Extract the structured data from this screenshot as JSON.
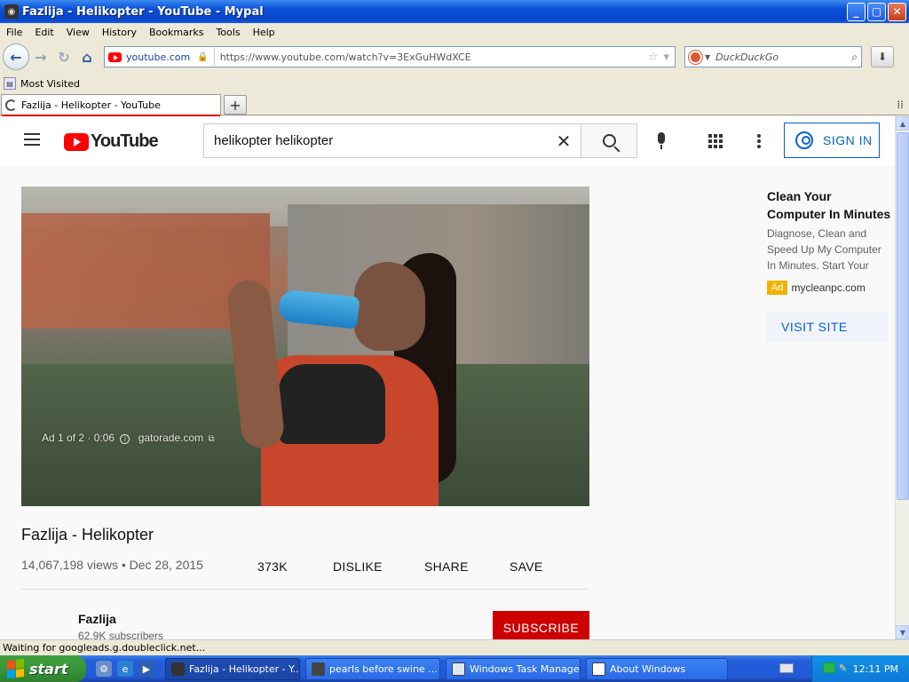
{
  "window": {
    "title": "Fazlija - Helikopter - YouTube - Mypal",
    "controls": {
      "minimize": "_",
      "maximize": "▢",
      "close": "✕"
    }
  },
  "menu": [
    "File",
    "Edit",
    "View",
    "History",
    "Bookmarks",
    "Tools",
    "Help"
  ],
  "navbar": {
    "site_host": "youtube.com",
    "url": "https://www.youtube.com/watch?v=3ExGuHWdXCE",
    "search_placeholder": "DuckDuckGo"
  },
  "bookmarks": {
    "most_visited": "Most Visited"
  },
  "tabs": [
    {
      "label": "Fazlija - Helikopter - YouTube",
      "active": true
    }
  ],
  "youtube": {
    "logo_text": "YouTube",
    "search_query": "helikopter helikopter",
    "sign_in": "SIGN IN",
    "video": {
      "ad_label": "Ad 1 of 2 · 0:06",
      "ad_domain": "gatorade.com",
      "title": "Fazlija - Helikopter",
      "meta": "14,067,198 views • Dec 28, 2015",
      "likes": "373K",
      "dislike": "DISLIKE",
      "share": "SHARE",
      "save": "SAVE"
    },
    "channel": {
      "name": "Fazlija",
      "subscribers": "62.9K subscribers",
      "subscribe": "SUBSCRIBE"
    },
    "side_ad": {
      "title": "Clean Your Computer In Minutes",
      "description": "Diagnose, Clean and Speed Up My Computer In Minutes. Start Your",
      "badge": "Ad",
      "domain": "mycleanpc.com",
      "cta": "VISIT SITE"
    }
  },
  "status": "Waiting for googleads.g.doubleclick.net...",
  "taskbar": {
    "start": "start",
    "tasks": [
      {
        "label": "Fazlija - Helikopter - Y...",
        "active": true
      },
      {
        "label": "pearls before swine ...",
        "active": false
      },
      {
        "label": "Windows Task Manager",
        "active": false
      },
      {
        "label": "About Windows",
        "active": false
      }
    ],
    "clock": "12:11 PM"
  },
  "colors": {
    "youtube_red": "#ff0000",
    "link_blue": "#065fd4",
    "subscribe_red": "#cc0000",
    "xp_taskbar": "#245edb",
    "xp_start": "#3a9a3a"
  }
}
